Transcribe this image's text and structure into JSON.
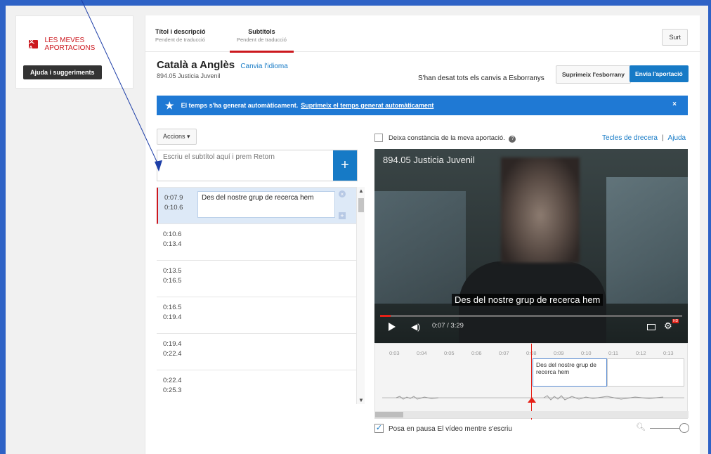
{
  "sidebar": {
    "my_contributions": "LES MEVES APORTACIONS",
    "help_button": "Ajuda i suggeriments"
  },
  "tabs": [
    {
      "title": "Títol i descripció",
      "status": "Pendent de traducció"
    },
    {
      "title": "Subtítols",
      "status": "Pendent de traducció",
      "active": true
    }
  ],
  "exit_button": "Surt",
  "header": {
    "language_pair": "Català a Anglès",
    "change_language": "Canvia l'idioma",
    "video_title": "894.05 Justicia Juvenil",
    "saved_status": "S'han desat tots els canvis a Esborranys",
    "delete_draft": "Suprimeix l'esborrany",
    "submit": "Envia l'aportació"
  },
  "banner": {
    "message": "El temps s'ha generat automàticament.",
    "link": "Suprimeix el temps generat automàticament",
    "close": "×"
  },
  "editor": {
    "actions": "Accions",
    "input_placeholder": "Escriu el subtítol aquí i prem Retorn",
    "add": "+",
    "rows": [
      {
        "start": "0:07.9",
        "end": "0:10.6",
        "text": "Des del nostre grup de recerca hem"
      },
      {
        "start": "0:10.6",
        "end": "0:13.4",
        "text": ""
      },
      {
        "start": "0:13.5",
        "end": "0:16.5",
        "text": ""
      },
      {
        "start": "0:16.5",
        "end": "0:19.4",
        "text": ""
      },
      {
        "start": "0:19.4",
        "end": "0:22.4",
        "text": ""
      },
      {
        "start": "0:22.4",
        "end": "0:25.3",
        "text": ""
      }
    ]
  },
  "player": {
    "credit_label": "Deixa constància de la meva aportació.",
    "shortcuts": "Tecles de drecera",
    "help": "Ajuda",
    "overlay_title": "894.05 Justicia Juvenil",
    "caption": "Des del nostre grup de recerca hem",
    "time": "0:07 / 3:29",
    "hd": "HD",
    "progress_fraction": 0.036
  },
  "timeline": {
    "ticks": [
      "0:03",
      "0:04",
      "0:05",
      "0:06",
      "0:07",
      "0:08",
      "0:09",
      "0:10",
      "0:11",
      "0:12",
      "0:13"
    ],
    "cue_text": "Des del nostre grup de recerca hem"
  },
  "footer": {
    "pause_label": "Posa en pausa El vídeo mentre s'escriu"
  },
  "colors": {
    "accent": "#167ac6",
    "brand_red": "#cc181e",
    "banner": "#1f79d4"
  }
}
